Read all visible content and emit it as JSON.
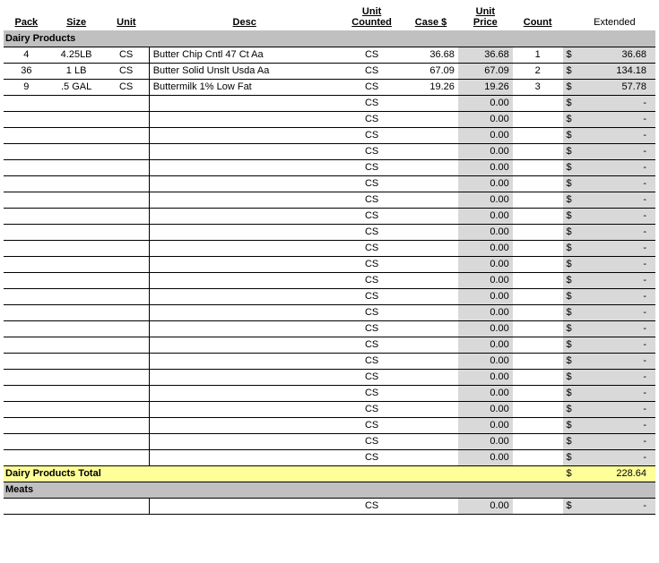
{
  "headers": {
    "pack": "Pack",
    "size": "Size",
    "unit": "Unit",
    "desc": "Desc",
    "unit_counted": "Unit\nCounted",
    "case": "Case $",
    "unit_price": "Unit\nPrice",
    "count": "Count",
    "extended": "Extended"
  },
  "sections": [
    {
      "name": "Dairy Products",
      "rows": [
        {
          "pack": "4",
          "size": "4.25LB",
          "unit": "CS",
          "desc": "Butter Chip Cntl 47 Ct Aa",
          "uc": "CS",
          "case": "36.68",
          "uprice": "36.68",
          "count": "1",
          "dollar": "$",
          "ext": "36.68"
        },
        {
          "pack": "36",
          "size": "1 LB",
          "unit": "CS",
          "desc": "Butter Solid Unslt Usda Aa",
          "uc": "CS",
          "case": "67.09",
          "uprice": "67.09",
          "count": "2",
          "dollar": "$",
          "ext": "134.18"
        },
        {
          "pack": "9",
          "size": ".5 GAL",
          "unit": "CS",
          "desc": "Buttermilk 1% Low Fat",
          "uc": "CS",
          "case": "19.26",
          "uprice": "19.26",
          "count": "3",
          "dollar": "$",
          "ext": "57.78"
        },
        {
          "pack": "",
          "size": "",
          "unit": "",
          "desc": "",
          "uc": "CS",
          "case": "",
          "uprice": "0.00",
          "count": "",
          "dollar": "$",
          "ext": "-"
        },
        {
          "pack": "",
          "size": "",
          "unit": "",
          "desc": "",
          "uc": "CS",
          "case": "",
          "uprice": "0.00",
          "count": "",
          "dollar": "$",
          "ext": "-"
        },
        {
          "pack": "",
          "size": "",
          "unit": "",
          "desc": "",
          "uc": "CS",
          "case": "",
          "uprice": "0.00",
          "count": "",
          "dollar": "$",
          "ext": "-"
        },
        {
          "pack": "",
          "size": "",
          "unit": "",
          "desc": "",
          "uc": "CS",
          "case": "",
          "uprice": "0.00",
          "count": "",
          "dollar": "$",
          "ext": "-"
        },
        {
          "pack": "",
          "size": "",
          "unit": "",
          "desc": "",
          "uc": "CS",
          "case": "",
          "uprice": "0.00",
          "count": "",
          "dollar": "$",
          "ext": "-"
        },
        {
          "pack": "",
          "size": "",
          "unit": "",
          "desc": "",
          "uc": "CS",
          "case": "",
          "uprice": "0.00",
          "count": "",
          "dollar": "$",
          "ext": "-"
        },
        {
          "pack": "",
          "size": "",
          "unit": "",
          "desc": "",
          "uc": "CS",
          "case": "",
          "uprice": "0.00",
          "count": "",
          "dollar": "$",
          "ext": "-"
        },
        {
          "pack": "",
          "size": "",
          "unit": "",
          "desc": "",
          "uc": "CS",
          "case": "",
          "uprice": "0.00",
          "count": "",
          "dollar": "$",
          "ext": "-"
        },
        {
          "pack": "",
          "size": "",
          "unit": "",
          "desc": "",
          "uc": "CS",
          "case": "",
          "uprice": "0.00",
          "count": "",
          "dollar": "$",
          "ext": "-"
        },
        {
          "pack": "",
          "size": "",
          "unit": "",
          "desc": "",
          "uc": "CS",
          "case": "",
          "uprice": "0.00",
          "count": "",
          "dollar": "$",
          "ext": "-"
        },
        {
          "pack": "",
          "size": "",
          "unit": "",
          "desc": "",
          "uc": "CS",
          "case": "",
          "uprice": "0.00",
          "count": "",
          "dollar": "$",
          "ext": "-"
        },
        {
          "pack": "",
          "size": "",
          "unit": "",
          "desc": "",
          "uc": "CS",
          "case": "",
          "uprice": "0.00",
          "count": "",
          "dollar": "$",
          "ext": "-"
        },
        {
          "pack": "",
          "size": "",
          "unit": "",
          "desc": "",
          "uc": "CS",
          "case": "",
          "uprice": "0.00",
          "count": "",
          "dollar": "$",
          "ext": "-"
        },
        {
          "pack": "",
          "size": "",
          "unit": "",
          "desc": "",
          "uc": "CS",
          "case": "",
          "uprice": "0.00",
          "count": "",
          "dollar": "$",
          "ext": "-"
        },
        {
          "pack": "",
          "size": "",
          "unit": "",
          "desc": "",
          "uc": "CS",
          "case": "",
          "uprice": "0.00",
          "count": "",
          "dollar": "$",
          "ext": "-"
        },
        {
          "pack": "",
          "size": "",
          "unit": "",
          "desc": "",
          "uc": "CS",
          "case": "",
          "uprice": "0.00",
          "count": "",
          "dollar": "$",
          "ext": "-"
        },
        {
          "pack": "",
          "size": "",
          "unit": "",
          "desc": "",
          "uc": "CS",
          "case": "",
          "uprice": "0.00",
          "count": "",
          "dollar": "$",
          "ext": "-"
        },
        {
          "pack": "",
          "size": "",
          "unit": "",
          "desc": "",
          "uc": "CS",
          "case": "",
          "uprice": "0.00",
          "count": "",
          "dollar": "$",
          "ext": "-"
        },
        {
          "pack": "",
          "size": "",
          "unit": "",
          "desc": "",
          "uc": "CS",
          "case": "",
          "uprice": "0.00",
          "count": "",
          "dollar": "$",
          "ext": "-"
        },
        {
          "pack": "",
          "size": "",
          "unit": "",
          "desc": "",
          "uc": "CS",
          "case": "",
          "uprice": "0.00",
          "count": "",
          "dollar": "$",
          "ext": "-"
        },
        {
          "pack": "",
          "size": "",
          "unit": "",
          "desc": "",
          "uc": "CS",
          "case": "",
          "uprice": "0.00",
          "count": "",
          "dollar": "$",
          "ext": "-"
        },
        {
          "pack": "",
          "size": "",
          "unit": "",
          "desc": "",
          "uc": "CS",
          "case": "",
          "uprice": "0.00",
          "count": "",
          "dollar": "$",
          "ext": "-"
        },
        {
          "pack": "",
          "size": "",
          "unit": "",
          "desc": "",
          "uc": "CS",
          "case": "",
          "uprice": "0.00",
          "count": "",
          "dollar": "$",
          "ext": "-"
        }
      ],
      "total": {
        "label": "Dairy Products Total",
        "dollar": "$",
        "ext": "228.64"
      }
    },
    {
      "name": "Meats",
      "rows": [
        {
          "pack": "",
          "size": "",
          "unit": "",
          "desc": "",
          "uc": "CS",
          "case": "",
          "uprice": "0.00",
          "count": "",
          "dollar": "$",
          "ext": "-"
        }
      ]
    }
  ]
}
